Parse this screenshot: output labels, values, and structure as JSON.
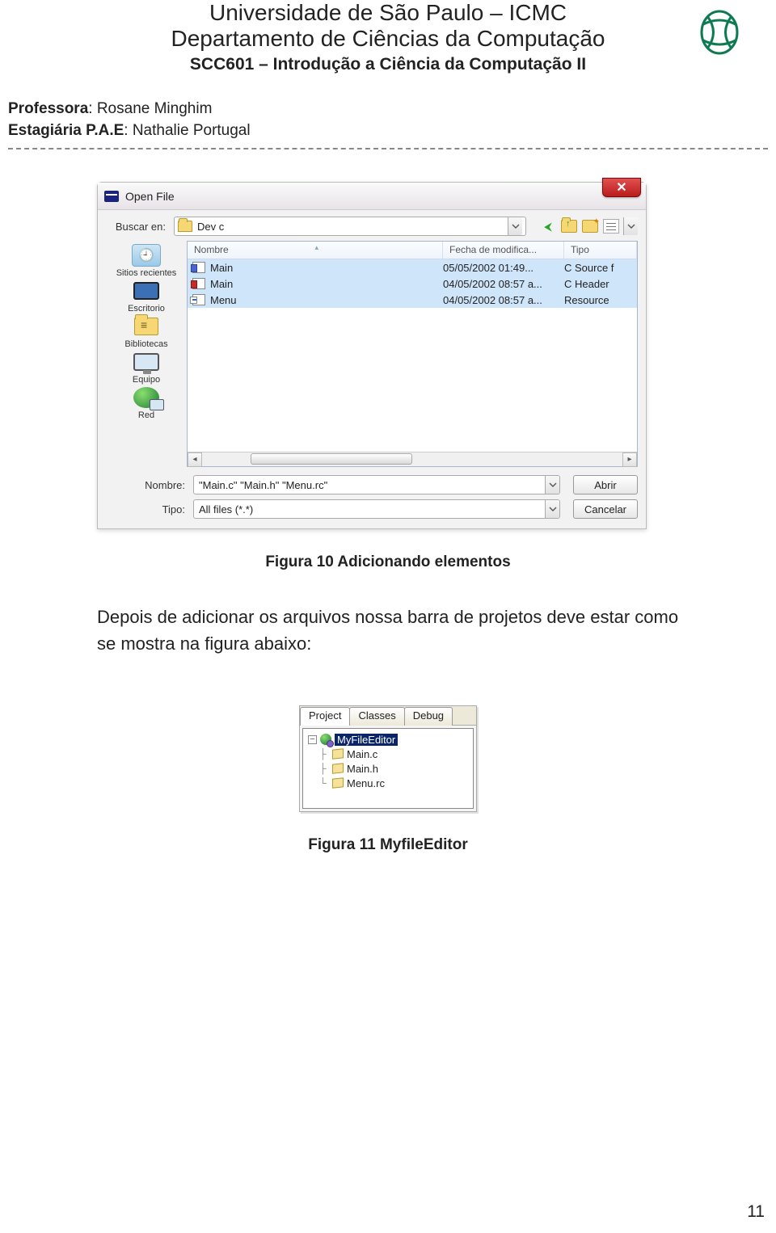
{
  "header": {
    "line1": "Universidade de São Paulo – ICMC",
    "line2": "Departamento de Ciências da Computação",
    "line3": "SCC601 – Introdução a Ciência da Computação II"
  },
  "meta": {
    "prof_label": "Professora",
    "prof_name": ": Rosane Minghim",
    "est_label": "Estagiária P.A.E",
    "est_name": ": Nathalie Portugal"
  },
  "dialog": {
    "title": "Open File",
    "close_glyph": "✕",
    "find_label": "Buscar en:",
    "find_value": "Dev c",
    "columns": {
      "name": "Nombre",
      "date": "Fecha de modifica...",
      "type": "Tipo"
    },
    "rows": [
      {
        "name": "Main",
        "date": "05/05/2002 01:49...",
        "type": "C Source f",
        "icon": "c",
        "selected": true
      },
      {
        "name": "Main",
        "date": "04/05/2002 08:57 a...",
        "type": "C Header",
        "icon": "h",
        "selected": true
      },
      {
        "name": "Menu",
        "date": "04/05/2002 08:57 a...",
        "type": "Resource",
        "icon": "r",
        "selected": true
      }
    ],
    "places": {
      "recent": "Sitios recientes",
      "desktop": "Escritorio",
      "libraries": "Bibliotecas",
      "computer": "Equipo",
      "network": "Red"
    },
    "name_label": "Nombre:",
    "name_value": "\"Main.c\" \"Main.h\" \"Menu.rc\"",
    "type_label": "Tipo:",
    "type_value": "All files (*.*)",
    "open_btn": "Abrir",
    "cancel_btn": "Cancelar",
    "scroll": {
      "left": "◂",
      "right": "▸",
      "thumb": "⋮⋮"
    }
  },
  "caption1": "Figura 10 Adicionando elementos",
  "paragraph": "Depois de adicionar os arquivos nossa barra de projetos deve estar como se mostra na figura abaixo:",
  "panel": {
    "tabs": {
      "project": "Project",
      "classes": "Classes",
      "debug": "Debug"
    },
    "root": "MyFileEditor",
    "items": [
      "Main.c",
      "Main.h",
      "Menu.rc"
    ],
    "minus": "−"
  },
  "caption2": "Figura 11 MyfileEditor",
  "page_number": "11"
}
